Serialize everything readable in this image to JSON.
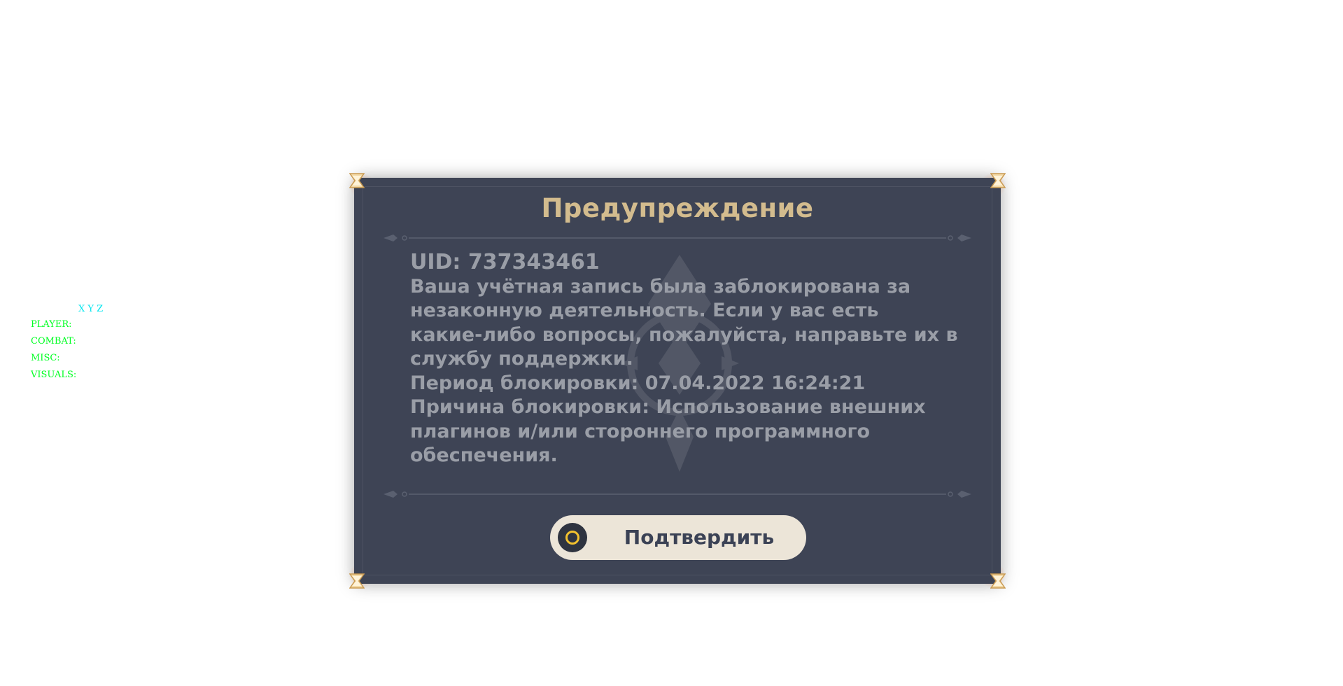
{
  "overlay_menu": {
    "coords_label": "X Y Z",
    "items": [
      {
        "label": "PLAYER:"
      },
      {
        "label": "COMBAT:"
      },
      {
        "label": "MISC:"
      },
      {
        "label": "VISUALS:"
      }
    ],
    "colors": {
      "coords": "#00e5ee",
      "items": "#00ff22"
    }
  },
  "dialog": {
    "title": "Предупреждение",
    "uid_line": "UID: 737343461",
    "message_lines": [
      "Ваша учётная запись была заблокирована за",
      "незаконную деятельность. Если у вас есть",
      "какие-либо вопросы, пожалуйста, направьте их в",
      "службу поддержки.",
      "Период блокировки: 07.04.2022 16:24:21",
      "Причина блокировки: Использование внешних",
      "плагинов и/или стороннего программного",
      "обеспечения."
    ],
    "confirm_button": {
      "label": "Подтвердить",
      "icon": "circle-button-icon"
    },
    "colors": {
      "background": "#3e4455",
      "title": "#d3bc8e",
      "text": "#9a9ea7",
      "button_bg": "#ece5d8",
      "button_text": "#3b4255",
      "button_icon_ring": "#f2c12e"
    }
  }
}
